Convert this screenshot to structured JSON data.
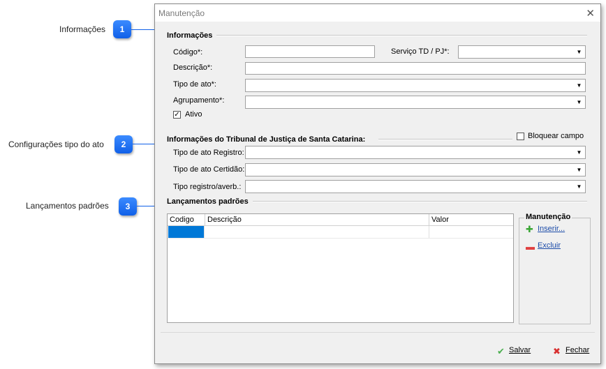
{
  "annotations": [
    {
      "label": "Informações",
      "number": "1"
    },
    {
      "label": "Configurações tipo do ato",
      "number": "2"
    },
    {
      "label": "Lançamentos padrões",
      "number": "3"
    }
  ],
  "window": {
    "title": "Manutenção",
    "close_glyph": "✕"
  },
  "informacoes": {
    "section_title": "Informações",
    "codigo_label": "Código*:",
    "codigo_value": "",
    "servico_label": "Serviço TD / PJ*:",
    "servico_value": "",
    "descricao_label": "Descrição*:",
    "descricao_value": "",
    "tipo_ato_label": "Tipo de ato*:",
    "tipo_ato_value": "",
    "agrupamento_label": "Agrupamento*:",
    "agrupamento_value": "",
    "ativo_label": "Ativo",
    "ativo_checked": true
  },
  "tribunal": {
    "section_title": "Informações do Tribunal de Justiça de Santa Catarina:",
    "bloquear_label": "Bloquear campo",
    "bloquear_checked": false,
    "registro_label": "Tipo de ato Registro:",
    "registro_value": "",
    "certidao_label": "Tipo de ato Certidão:",
    "certidao_value": "",
    "averb_label": "Tipo registro/averb.:",
    "averb_value": ""
  },
  "lancamentos": {
    "section_title": "Lançamentos padrões",
    "columns": [
      "Codigo",
      "Descrição",
      "Valor"
    ],
    "selection_color": "#0078d7"
  },
  "manutencao": {
    "title": "Manutenção",
    "inserir_label": "Inserir...",
    "excluir_label": "Excluir",
    "inserir_icon_color": "#3aa635",
    "excluir_icon_color": "#e04040"
  },
  "footer": {
    "salvar_label": "Salvar",
    "fechar_label": "Fechar",
    "salvar_icon_color": "#4caf50",
    "fechar_icon_color": "#d83030"
  },
  "accent_color": "#1060e8"
}
